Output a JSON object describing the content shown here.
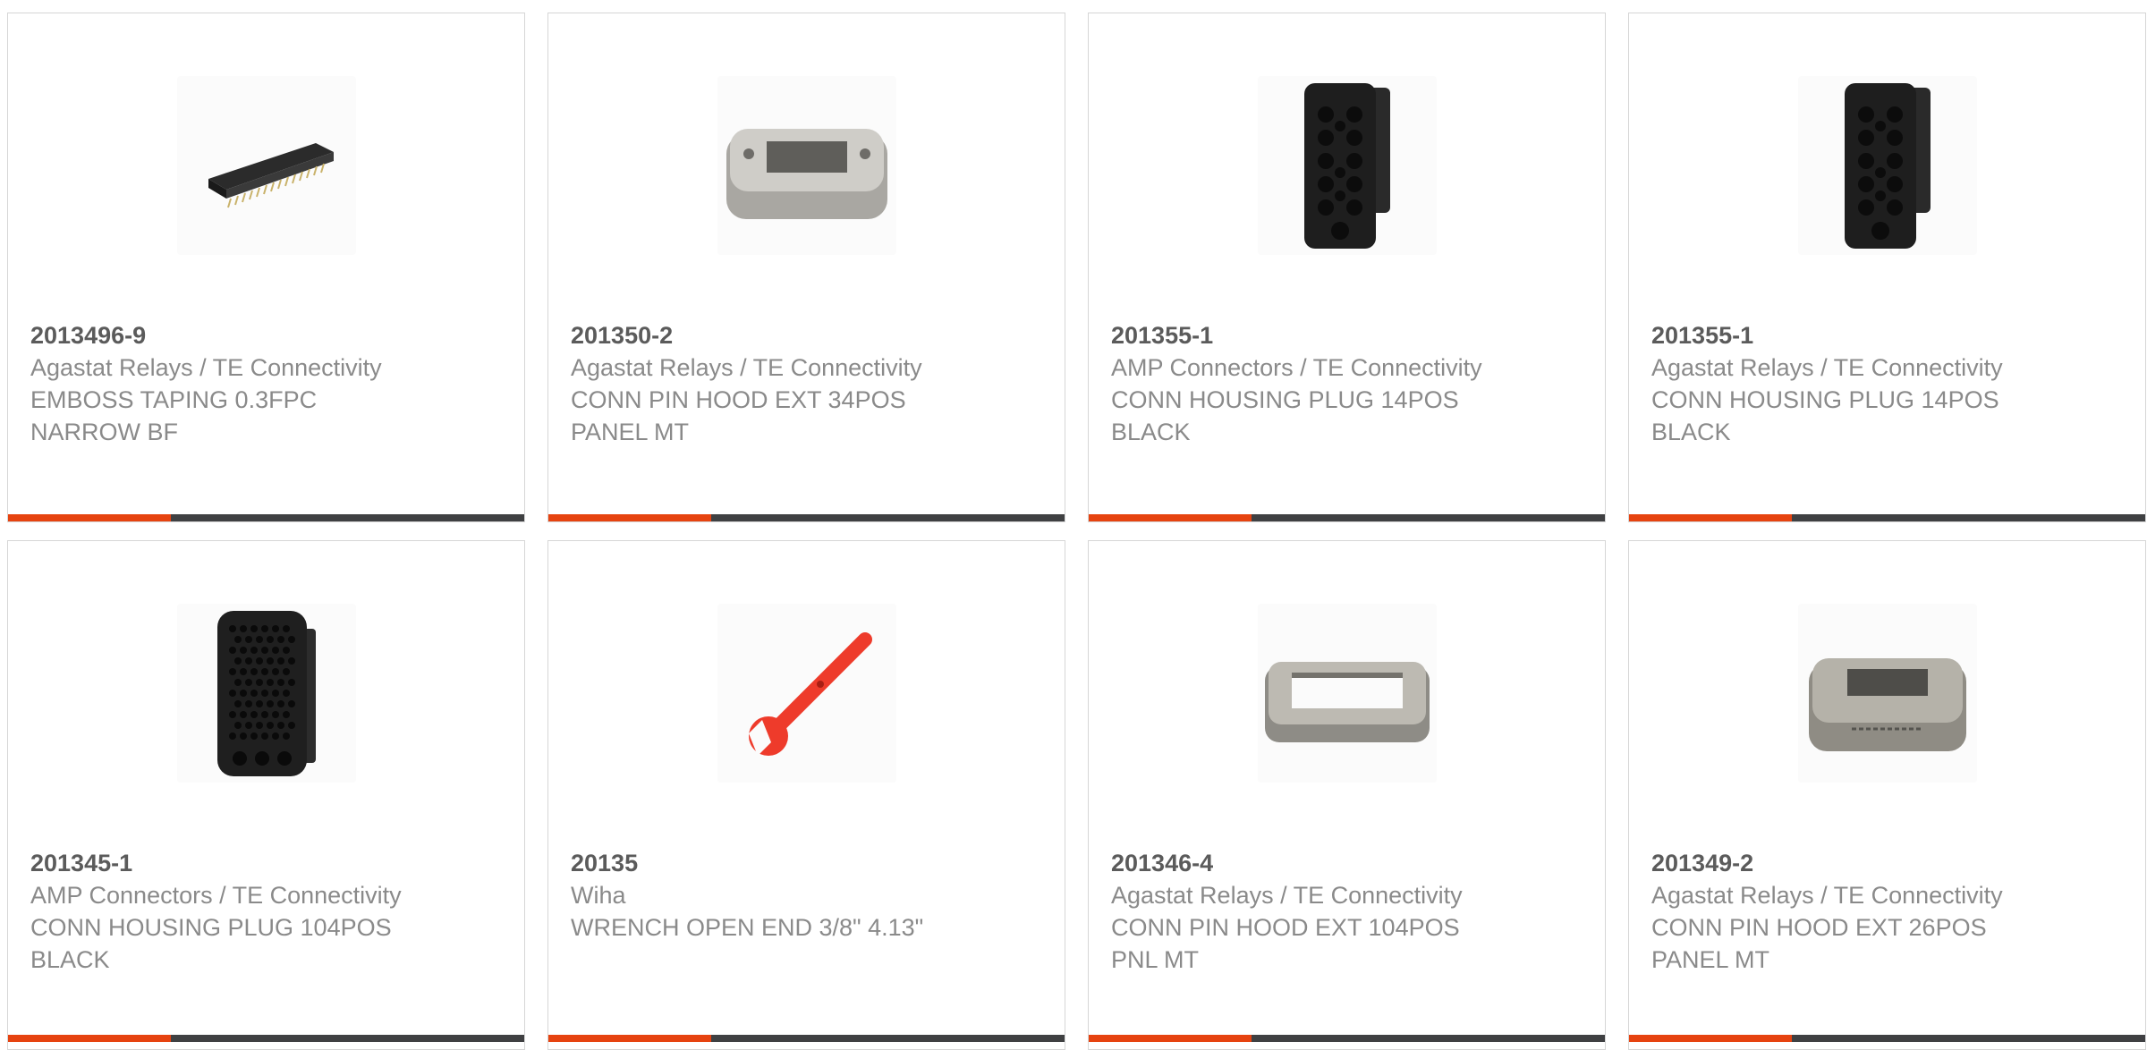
{
  "colors": {
    "accent": "#e64310",
    "bar": "#3f4042",
    "part_number": "#5b5b5b",
    "text": "#8a8a8a",
    "border": "#d6d6d6"
  },
  "products": [
    {
      "part_number": "2013496-9",
      "manufacturer": "Agastat Relays / TE Connectivity",
      "description": "EMBOSS TAPING 0.3FPC NARROW BF",
      "image": "fpc-connector-image"
    },
    {
      "part_number": "201350-2",
      "manufacturer": "Agastat Relays / TE Connectivity",
      "description": "CONN PIN HOOD EXT 34POS PANEL MT",
      "image": "metal-hood-image"
    },
    {
      "part_number": "201355-1",
      "manufacturer": "AMP Connectors / TE Connectivity",
      "description": "CONN HOUSING PLUG 14POS BLACK",
      "image": "plug-housing-14pos-image"
    },
    {
      "part_number": "201355-1",
      "manufacturer": "Agastat Relays / TE Connectivity",
      "description": "CONN HOUSING PLUG 14POS BLACK",
      "image": "plug-housing-14pos-image"
    },
    {
      "part_number": "201345-1",
      "manufacturer": "AMP Connectors / TE Connectivity",
      "description": "CONN HOUSING PLUG 104POS BLACK",
      "image": "plug-housing-104pos-image"
    },
    {
      "part_number": "20135",
      "manufacturer": "Wiha",
      "description": "WRENCH OPEN END 3/8\" 4.13\"",
      "image": "wrench-image"
    },
    {
      "part_number": "201346-4",
      "manufacturer": "Agastat Relays / TE Connectivity",
      "description": "CONN PIN HOOD EXT 104POS PNL MT",
      "image": "metal-frame-image"
    },
    {
      "part_number": "201349-2",
      "manufacturer": "Agastat Relays / TE Connectivity",
      "description": "CONN PIN HOOD EXT 26POS PANEL MT",
      "image": "metal-hood-marked-image"
    }
  ]
}
